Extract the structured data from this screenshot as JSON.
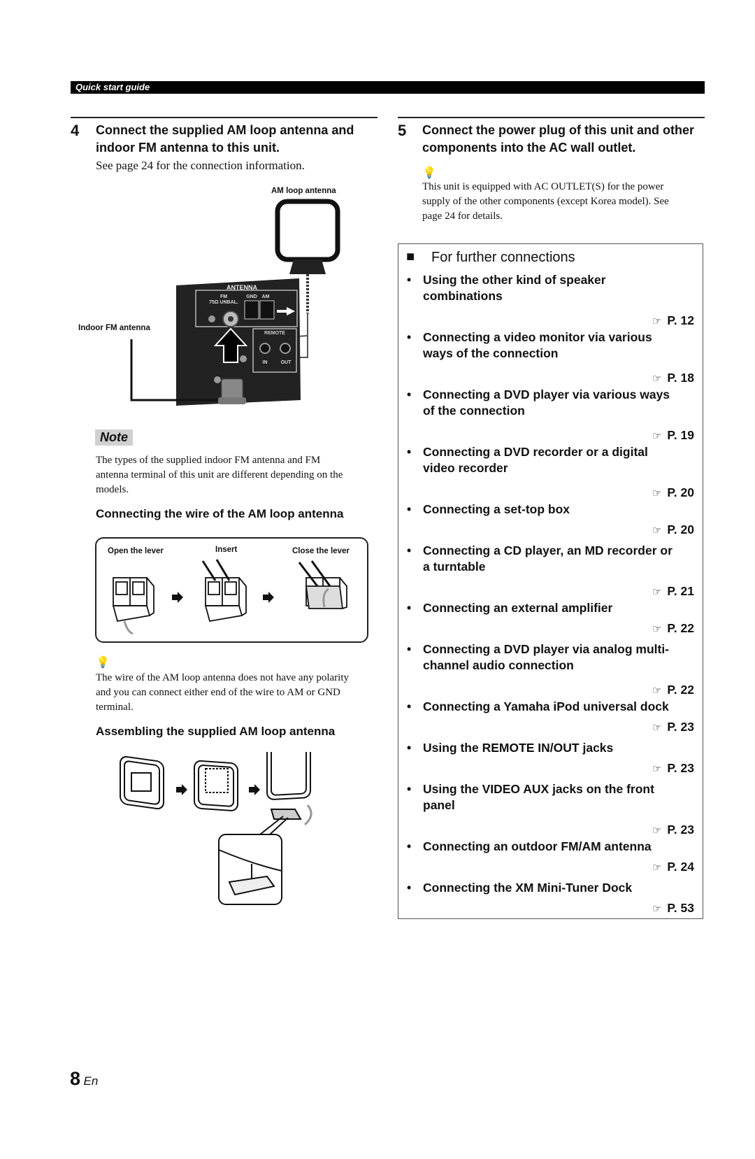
{
  "header": {
    "section_label": "Quick start guide"
  },
  "step4": {
    "number": "4",
    "title_line1": "Connect the supplied AM loop antenna and",
    "title_line2": "indoor FM antenna to this unit.",
    "subtitle": "See page 24 for the connection information.",
    "figure": {
      "am_label": "AM loop antenna",
      "fm_label": "Indoor FM antenna",
      "panel_antenna": "ANTENNA",
      "panel_fm": "FM",
      "panel_fm_imp": "75Ω UNBAL.",
      "panel_gnd": "GND",
      "panel_am": "AM",
      "panel_remote": "REMOTE",
      "panel_in": "IN",
      "panel_out": "OUT"
    },
    "note": {
      "label": "Note",
      "line1": "The types of the supplied indoor FM antenna and FM",
      "line2": "antenna terminal of this unit are different depending on the",
      "line3": "models."
    },
    "wire_section": {
      "title": "Connecting the wire of the AM loop antenna",
      "step_open": "Open the lever",
      "step_insert": "Insert",
      "step_close": "Close the lever"
    },
    "tip": {
      "icon": "lightbulb-tip-icon",
      "line1": "The wire of the AM loop antenna does not have any polarity",
      "line2": "and you can connect either end of the wire to AM or GND",
      "line3": "terminal."
    },
    "assemble_section": {
      "title": "Assembling the supplied AM loop antenna"
    }
  },
  "step5": {
    "number": "5",
    "title_line1": "Connect the power plug of this unit and other",
    "title_line2": "components into the AC wall outlet.",
    "tip": {
      "icon": "lightbulb-tip-icon",
      "line1": "This unit is equipped with AC OUTLET(S) for the power",
      "line2": "supply of the other components (except Korea model). See",
      "line3": "page 24 for details."
    }
  },
  "further": {
    "marker": "■",
    "title": "For further connections",
    "ref_icon": "☞",
    "items": [
      {
        "line1": "Using the other kind of speaker",
        "line2": "combinations",
        "ref": "P. 12"
      },
      {
        "line1": "Connecting a video monitor via various",
        "line2": "ways of the connection",
        "ref": "P. 18"
      },
      {
        "line1": "Connecting a DVD player via various ways",
        "line2": "of the connection",
        "ref": "P. 19"
      },
      {
        "line1": "Connecting a DVD recorder or a digital",
        "line2": "video recorder",
        "ref": "P. 20"
      },
      {
        "line1": "Connecting a set-top box",
        "line2": "",
        "ref": "P. 20"
      },
      {
        "line1": "Connecting a CD player, an MD recorder or",
        "line2": "a turntable",
        "ref": "P. 21"
      },
      {
        "line1": "Connecting an external amplifier",
        "line2": "",
        "ref": "P. 22"
      },
      {
        "line1": "Connecting a DVD player via analog multi-",
        "line2": "channel audio connection",
        "ref": "P. 22"
      },
      {
        "line1": "Connecting a Yamaha iPod universal dock",
        "line2": "",
        "ref": "P. 23"
      },
      {
        "line1": "Using the REMOTE IN/OUT jacks",
        "line2": "",
        "ref": "P. 23"
      },
      {
        "line1": "Using the VIDEO AUX jacks on the front",
        "line2": "panel",
        "ref": "P. 23"
      },
      {
        "line1": "Connecting an outdoor FM/AM antenna",
        "line2": "",
        "ref": "P. 24"
      },
      {
        "line1": "Connecting the XM Mini-Tuner Dock",
        "line2": "",
        "ref": "P. 53"
      }
    ]
  },
  "footer": {
    "page_number": "8",
    "lang": "En"
  }
}
